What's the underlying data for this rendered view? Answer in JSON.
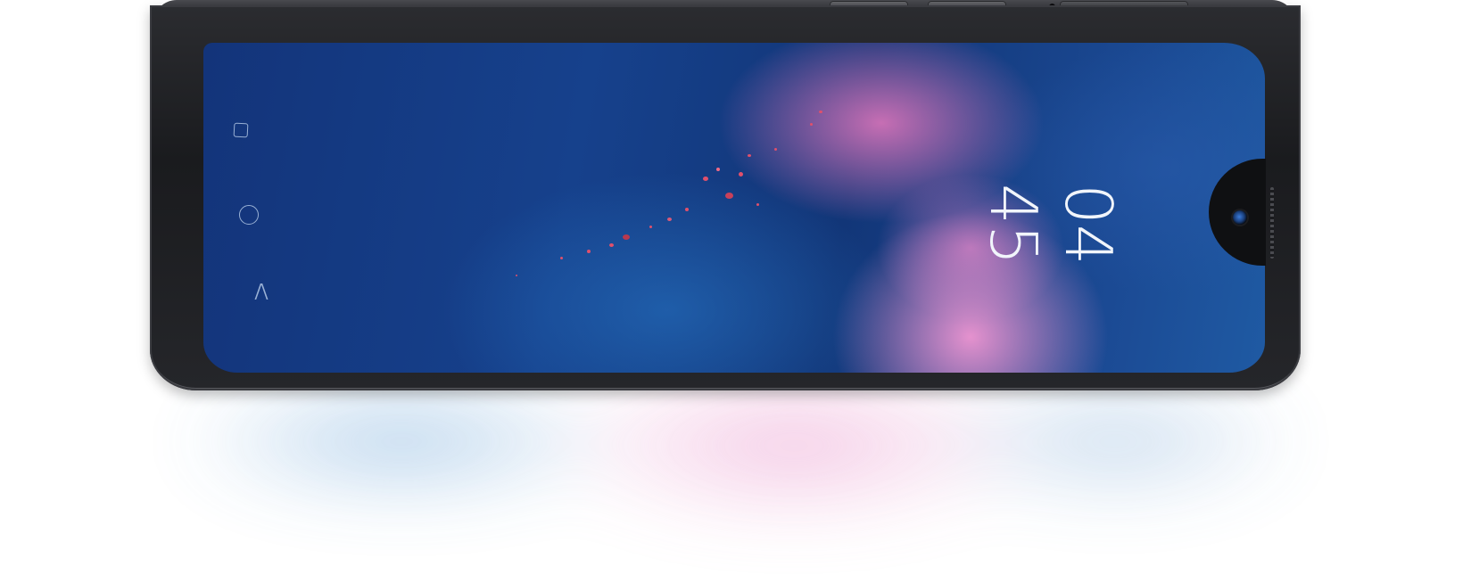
{
  "lock_screen": {
    "clock": {
      "hours": "04",
      "minutes": "45"
    }
  },
  "navigation_bar": {
    "items": [
      {
        "icon": "square-recents-icon"
      },
      {
        "icon": "circle-home-icon"
      },
      {
        "icon": "triangle-back-icon"
      }
    ]
  },
  "colors": {
    "wallpaper_blue": "#16418c",
    "wallpaper_pink": "#e98fcc",
    "phone_body": "#1a1b1e",
    "clock_text": "#f1f5fb"
  }
}
